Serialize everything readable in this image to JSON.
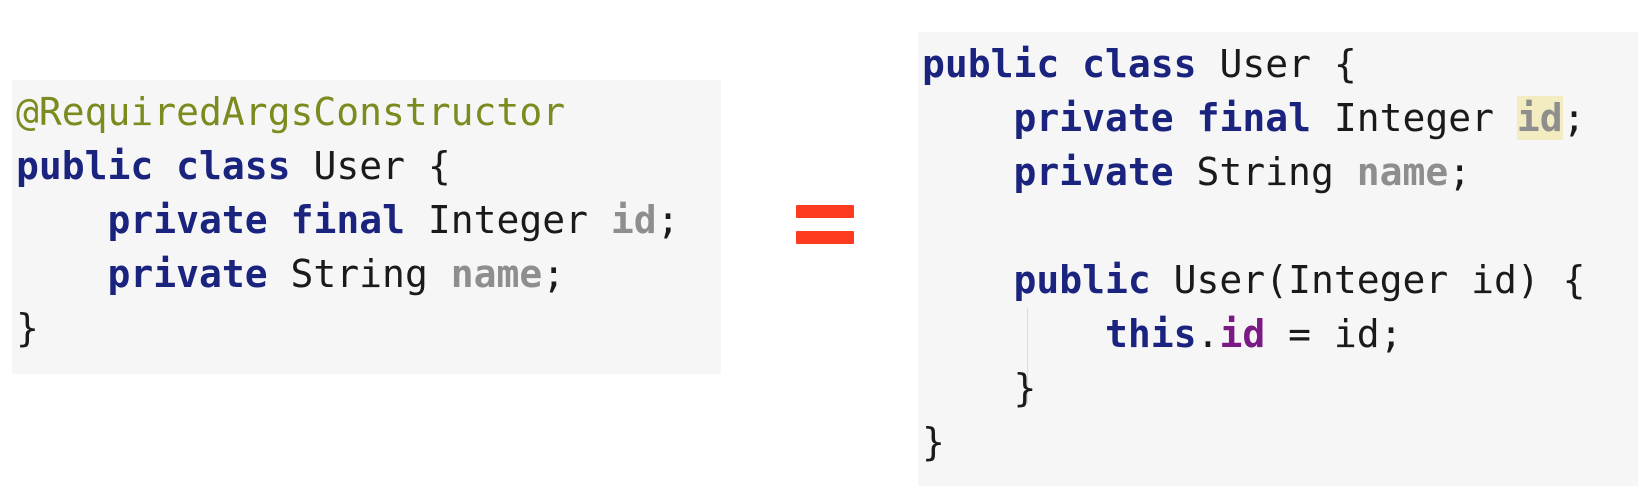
{
  "left_code": {
    "annotation": "@RequiredArgsConstructor",
    "line_class": {
      "kw_public": "public",
      "kw_class": "class",
      "rest": " User {"
    },
    "line_id": {
      "kw_private": "private",
      "kw_final": "final",
      "type": " Integer ",
      "field": "id",
      "end": ";"
    },
    "line_name": {
      "kw_private": "private",
      "type": " String ",
      "field": "name",
      "end": ";"
    },
    "closing": "}"
  },
  "equals_symbol": "=",
  "right_code": {
    "line_class": {
      "kw_public": "public",
      "kw_class": "class",
      "rest": " User {"
    },
    "line_id": {
      "kw_private": "private",
      "kw_final": "final",
      "type": " Integer ",
      "field": "id",
      "end": ";"
    },
    "line_name": {
      "kw_private": "private",
      "type": " String ",
      "field": "name",
      "end": ";"
    },
    "line_ctor": {
      "kw_public": "public",
      "rest": " User(Integer id) {"
    },
    "line_assign": {
      "kw_this": "this",
      "dot": ".",
      "field": "id",
      "rest": " = id;"
    },
    "ctor_close": "}",
    "closing": "}"
  },
  "colors": {
    "keyword": "#1a237e",
    "annotation": "#7c8a1e",
    "field": "#8e8e8e",
    "instance_field": "#7b1a84",
    "highlight": "#f3ecc0",
    "equals": "#ff3b1f",
    "panel_bg": "#f6f6f7"
  }
}
